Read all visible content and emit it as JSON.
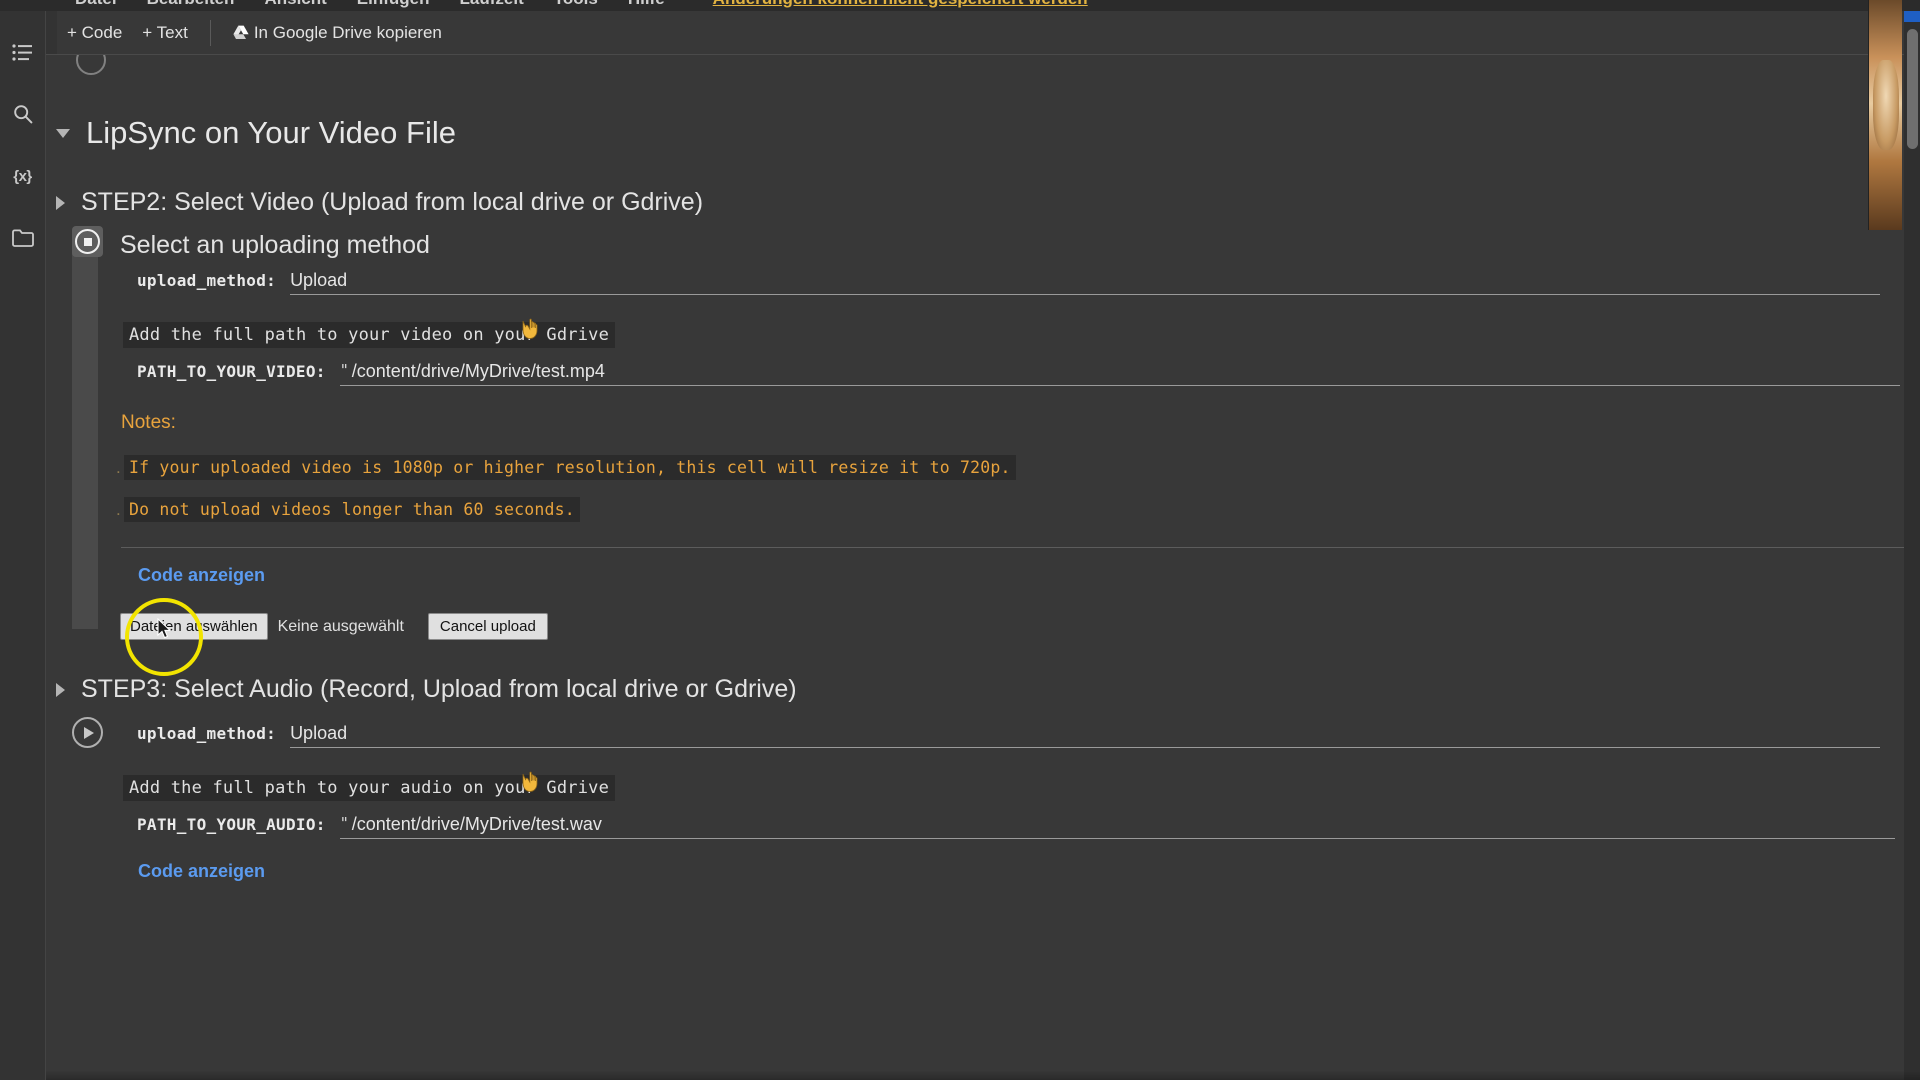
{
  "app": {
    "theme_bg": "#383838",
    "accent_link": "#5b9bf0",
    "accent_orange": "#e8a33d",
    "cursor_highlight": "#f2e400"
  },
  "menubar": {
    "items": [
      "Datei",
      "Bearbeiten",
      "Ansicht",
      "Einfügen",
      "Laufzeit",
      "Tools",
      "Hilfe"
    ],
    "unsaved_notice": "Änderungen können nicht gespeichert werden"
  },
  "toolbar": {
    "add_code_label": "+ Code",
    "add_text_label": "+ Text",
    "copy_to_drive_label": "In Google Drive kopieren"
  },
  "sidebar": {
    "items": [
      {
        "name": "toc-icon",
        "label": "Inhaltsverzeichnis"
      },
      {
        "name": "search-icon",
        "label": "Suchen"
      },
      {
        "name": "variables-icon",
        "label": "{x}"
      },
      {
        "name": "files-icon",
        "label": "Dateien"
      }
    ]
  },
  "notebook": {
    "section_title": "LipSync on Your Video File",
    "step2": {
      "heading": "STEP2: Select Video (Upload from local drive or Gdrive)",
      "cell_title": "Select an uploading method",
      "upload_method_label": "upload_method:",
      "upload_method_value": "Upload",
      "gdrive_hint": "Add the full path to your video on your Gdrive",
      "hint_emoji": "point-down-hand",
      "path_label": "PATH_TO_YOUR_VIDEO:",
      "path_quote": "\"",
      "path_value": "/content/drive/MyDrive/test.mp4",
      "notes_title": "Notes:",
      "notes": [
        "If your uploaded video is 1080p or higher resolution, this cell will resize it to 720p.",
        "Do not upload videos longer than 60 seconds."
      ],
      "show_code_label": "Code anzeigen",
      "more_options": "…",
      "file_choose_label": "Dateien auswählen",
      "file_status": "Keine ausgewählt",
      "cancel_upload_label": "Cancel upload"
    },
    "step3": {
      "heading": "STEP3: Select Audio (Record, Upload from local drive or Gdrive)",
      "upload_method_label": "upload_method:",
      "upload_method_value": "Upload",
      "gdrive_hint": "Add the full path to your audio on your Gdrive",
      "hint_emoji": "point-down-hand",
      "path_label": "PATH_TO_YOUR_AUDIO:",
      "path_quote": "\"",
      "path_value": "/content/drive/MyDrive/test.wav",
      "show_code_label": "Code anzeigen"
    }
  }
}
